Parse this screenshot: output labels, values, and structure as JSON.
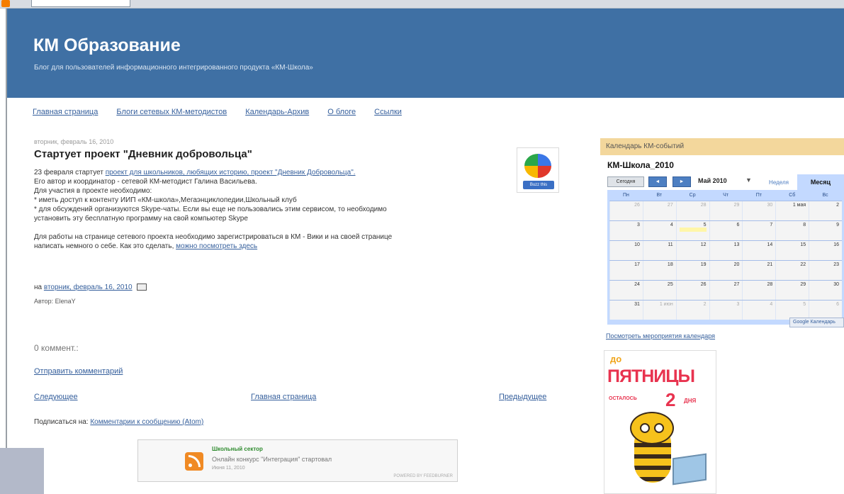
{
  "blog": {
    "title": "КМ Образование",
    "description": "Блог для пользователей информационного интегрированного продукта «КМ-Школа»"
  },
  "tabs": [
    "Главная страница",
    "Блоги сетевых КМ-методистов",
    "Календарь-Архив",
    "О блоге",
    "Ссылки"
  ],
  "post": {
    "date": "вторник, февраль 16, 2010",
    "title": "Стартует проект \"Дневник добровольца\"",
    "line1_prefix": "23 февраля стартует ",
    "line1_link": "проект для школьников, любящих историю, проект \"Дневник Добровольца\".",
    "line2": "Его автор и координатор - сетевой КМ-методист Галина Васильева.",
    "line3": "Для участия в проекте необходимо:",
    "line4": "* иметь доступ к контенту ИИП «КМ-школа»,Мегаэнциклопедии,Школьный клуб",
    "line5": "* для обсуждений организуются Skype-чаты. Если вы еще не пользовались этим сервисом, то необходимо",
    "line6": "установить эту бесплатную программу на свой компьютер Skype",
    "line7": "Для работы на странице сетевого проекта необходимо зарегистрироваться в КМ - Вики и на своей странице",
    "line8_prefix": "написать немного о себе. Как это сделать, ",
    "line8_link": "можно посмотреть здесь",
    "footer_prefix": "на ",
    "footer_link": "вторник, февраль 16, 2010",
    "author": "Автор: ElenaY",
    "buzz_label": "Buzz this"
  },
  "comments": {
    "count": "0 коммент.:",
    "send": "Отправить комментарий"
  },
  "pager": {
    "next": "Следующее",
    "home": "Главная страница",
    "prev": "Предыдущее"
  },
  "subscribe": {
    "label": "Подписаться на: ",
    "link": "Комментарии к сообщению (Atom)"
  },
  "feed": {
    "source": "Школьный сектор",
    "title": "Онлайн конкурс \"Интеграция\" стартовал",
    "date": "Июня 11, 2010",
    "powered": "POWERED BY FEEDBURNER"
  },
  "calendar": {
    "header": "Календарь КМ-событий",
    "name": "КМ-Школа_2010",
    "today": "Сегодня",
    "prev": "◄",
    "next": "►",
    "month": "Май 2010",
    "arrow": "▼",
    "tab_week": "Неделя",
    "tab_month": "Месяц",
    "dow": [
      "Пн",
      "Вт",
      "Ср",
      "Чт",
      "Пт",
      "Сб",
      "Вс"
    ],
    "weeks": [
      [
        "26",
        "27",
        "28",
        "29",
        "30",
        "1 мая",
        "2"
      ],
      [
        "3",
        "4",
        "5",
        "6",
        "7",
        "8",
        "9"
      ],
      [
        "10",
        "11",
        "12",
        "13",
        "14",
        "15",
        "16"
      ],
      [
        "17",
        "18",
        "19",
        "20",
        "21",
        "22",
        "23"
      ],
      [
        "24",
        "25",
        "26",
        "27",
        "28",
        "29",
        "30"
      ],
      [
        "31",
        "1 июн",
        "2",
        "3",
        "4",
        "5",
        "6"
      ]
    ],
    "badge": "Google Календарь",
    "view_events": "Посмотреть мероприятия календаря"
  },
  "friday": {
    "do": "до",
    "big": "ПЯТНИЦЫ",
    "left": "ОСТАЛОСЬ",
    "num": "2",
    "days": "ДНЯ"
  }
}
